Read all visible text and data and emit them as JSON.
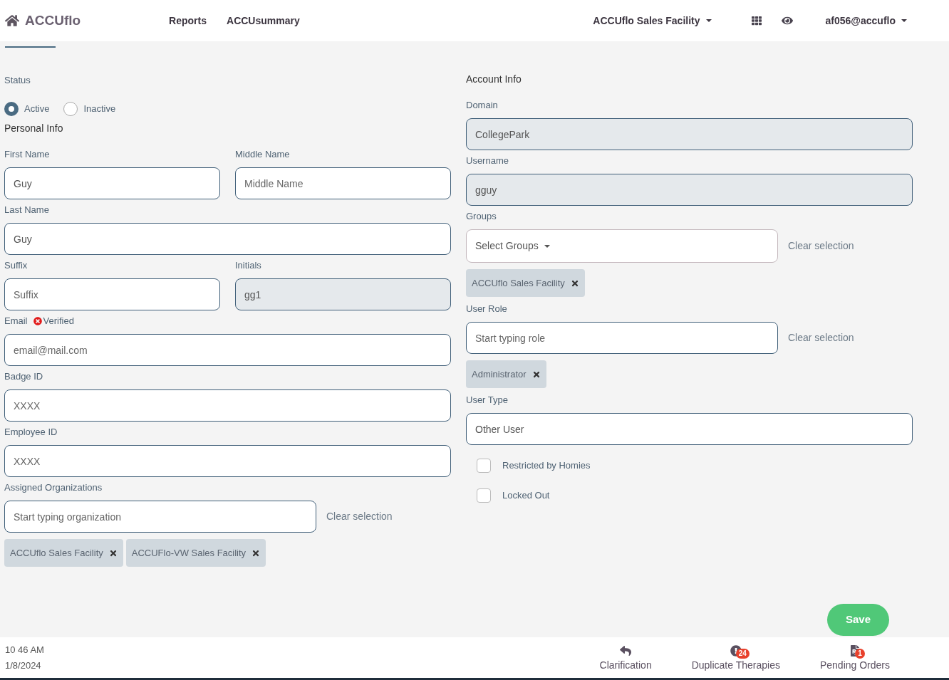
{
  "header": {
    "brand": "ACCUflo",
    "nav": [
      "Reports",
      "ACCUsummary"
    ],
    "facility": "ACCUflo Sales Facility",
    "user": "af056@accuflo"
  },
  "status": {
    "label": "Status",
    "options": [
      {
        "label": "Active",
        "selected": true
      },
      {
        "label": "Inactive",
        "selected": false
      }
    ]
  },
  "personal_info": {
    "title": "Personal Info",
    "rows": [
      [
        {
          "label": "First Name",
          "value": "Guy",
          "disabled": false
        },
        {
          "label": "Middle Name",
          "placeholder": "Middle Name",
          "disabled": false
        }
      ],
      [
        {
          "label": "Last Name",
          "value": "Guy",
          "disabled": false
        }
      ],
      [
        {
          "label": "Suffix",
          "placeholder": "Suffix",
          "disabled": false
        },
        {
          "label": "Initials",
          "value": "gg1",
          "disabled": true
        }
      ],
      [
        {
          "label": "Email",
          "placeholder": "email@mail.com",
          "disabled": false,
          "verification": {
            "text": "Verified",
            "verified": false
          }
        }
      ],
      [
        {
          "label": "Badge ID",
          "placeholder": "XXXX",
          "disabled": false
        }
      ],
      [
        {
          "label": "Employee ID",
          "placeholder": "XXXX",
          "disabled": false
        }
      ]
    ],
    "organizations": {
      "label": "Assigned Organizations",
      "placeholder": "Start typing organization",
      "clear": "Clear selection",
      "chips": [
        "ACCUflo Sales Facility",
        "ACCUFlo-VW Sales Facility"
      ]
    }
  },
  "account_info": {
    "title": "Account Info",
    "domain": {
      "label": "Domain",
      "value": "CollegePark",
      "disabled": true
    },
    "username": {
      "label": "Username",
      "value": "gguy",
      "disabled": true
    },
    "groups": {
      "label": "Groups",
      "select": "Select Groups",
      "clear": "Clear selection",
      "chips": [
        "ACCUflo Sales Facility"
      ]
    },
    "user_role": {
      "label": "User Role",
      "placeholder": "Start typing role",
      "clear": "Clear selection",
      "chips": [
        "Administrator"
      ]
    },
    "user_type": {
      "label": "User Type",
      "value": "Other User",
      "disabled": false
    },
    "checkboxes": [
      {
        "label": "Restricted by Homies",
        "checked": false
      },
      {
        "label": "Locked Out",
        "checked": false
      }
    ]
  },
  "save": "Save",
  "footer": {
    "time": "10 46 AM",
    "date": "1/8/2024",
    "actions": [
      {
        "kind": "reply",
        "label": "Clarification"
      },
      {
        "kind": "alert",
        "label": "Duplicate Therapies",
        "badge": "24"
      },
      {
        "kind": "prescription",
        "label": "Pending Orders",
        "badge": "1"
      }
    ]
  }
}
